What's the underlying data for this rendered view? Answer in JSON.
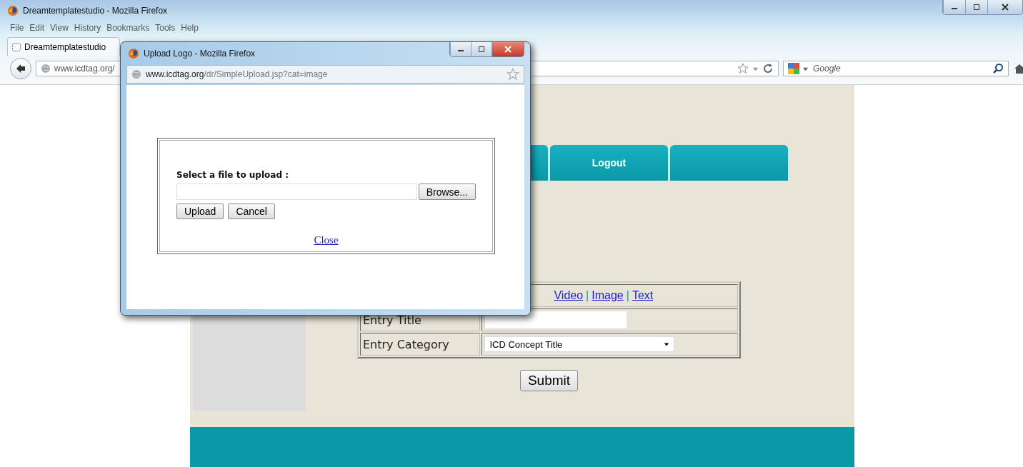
{
  "browser": {
    "title": "Dreamtemplatestudio - Mozilla Firefox",
    "menu": [
      "File",
      "Edit",
      "View",
      "History",
      "Bookmarks",
      "Tools",
      "Help"
    ],
    "tab": {
      "label": "Dreamtemplatestudio"
    },
    "url": "www.icdtag.org/",
    "search": {
      "placeholder": "Google"
    }
  },
  "page": {
    "nav_tabs": [
      {
        "kind": "blank"
      },
      {
        "kind": "text",
        "label": "Logout"
      },
      {
        "kind": "blank"
      }
    ],
    "links": [
      "Video",
      "Image",
      "Text"
    ],
    "link_separator": "|",
    "form_rows": [
      {
        "label": "Entry Title",
        "kind": "text"
      },
      {
        "label": "Entry Category",
        "kind": "select",
        "value": "ICD Concept Title"
      }
    ],
    "submit": "Submit"
  },
  "popup": {
    "title": "Upload Logo - Mozilla Firefox",
    "url_host": "www.icdtag.org",
    "url_path": "/dr/SimpleUpload.jsp?cat=image",
    "prompt": "Select a file to upload :",
    "browse": "Browse...",
    "buttons": [
      "Upload",
      "Cancel"
    ],
    "close_link": "Close"
  }
}
